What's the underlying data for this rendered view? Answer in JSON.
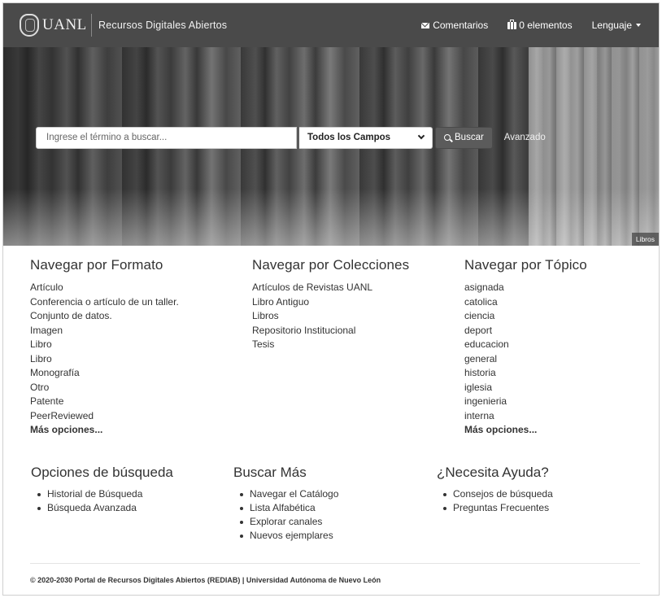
{
  "navbar": {
    "logo_text": "UANL",
    "brand": "Recursos Digitales Abiertos",
    "links": [
      {
        "label": "Comentarios",
        "icon": "envelope-icon"
      },
      {
        "label": "0 elementos",
        "icon": "briefcase-icon"
      },
      {
        "label": "Lenguaje",
        "icon": "caret-down-icon"
      }
    ]
  },
  "hero": {
    "search_placeholder": "Ingrese el término a buscar...",
    "search_value": "",
    "field_select": "Todos los Campos",
    "search_button": "Buscar",
    "advanced_link": "Avanzado",
    "caption": "Libros"
  },
  "browse": {
    "formato": {
      "title": "Navegar por Formato",
      "items": [
        "Artículo",
        "Conferencia o artículo de un taller.",
        "Conjunto de datos.",
        "Imagen",
        "Libro",
        "Libro",
        "Monografía",
        "Otro",
        "Patente",
        "PeerReviewed"
      ],
      "more": "Más opciones..."
    },
    "colecciones": {
      "title": "Navegar por Colecciones",
      "items": [
        "Artículos de Revistas UANL",
        "Libro Antiguo",
        "Libros",
        "Repositorio Institucional",
        "Tesis"
      ]
    },
    "topico": {
      "title": "Navegar por Tópico",
      "items": [
        "asignada",
        "catolica",
        "ciencia",
        "deport",
        "educacion",
        "general",
        "historia",
        "iglesia",
        "ingenieria",
        "interna"
      ],
      "more": "Más opciones..."
    }
  },
  "lower": {
    "opciones": {
      "title": "Opciones de búsqueda",
      "items": [
        "Historial de Búsqueda",
        "Búsqueda Avanzada"
      ]
    },
    "buscar_mas": {
      "title": "Buscar Más",
      "items": [
        "Navegar el Catálogo",
        "Lista Alfabética",
        "Explorar canales",
        "Nuevos ejemplares"
      ]
    },
    "ayuda": {
      "title": "¿Necesita Ayuda?",
      "items": [
        "Consejos de búsqueda",
        "Preguntas Frecuentes"
      ]
    }
  },
  "footer": {
    "copyright": "© 2020-2030 Portal de Recursos Digitales Abiertos (REDIAB) | Universidad Autónoma de Nuevo León"
  }
}
